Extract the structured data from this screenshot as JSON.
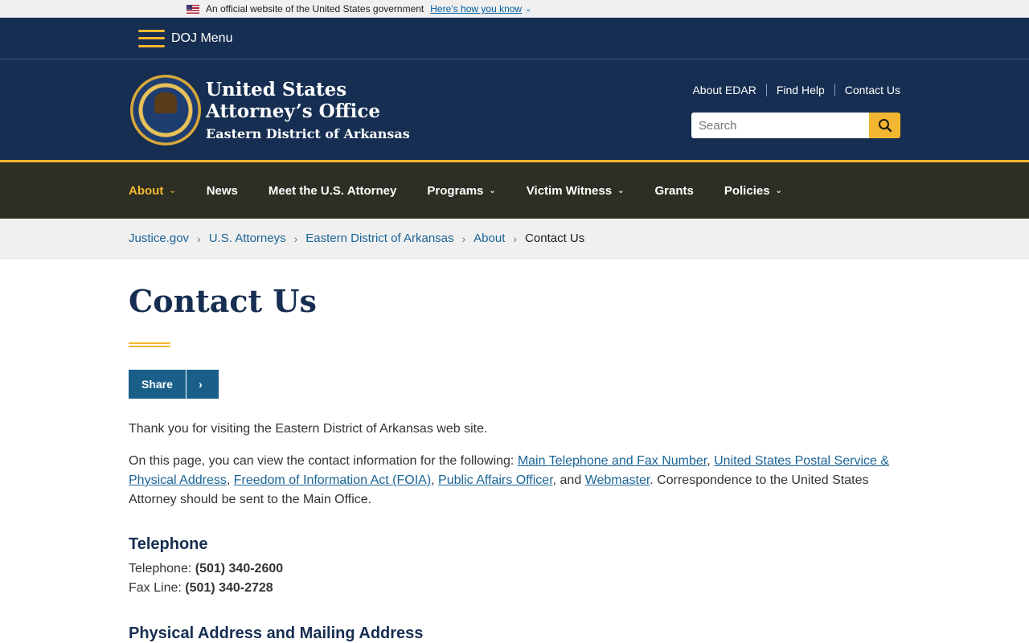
{
  "gov_banner": {
    "text": "An official website of the United States government",
    "link": "Here’s how you know"
  },
  "doj_menu": {
    "label": "DOJ Menu"
  },
  "header": {
    "title_line1": "United States",
    "title_line2": "Attorney’s Office",
    "title_line3": "Eastern District of Arkansas",
    "utility_links": [
      "About EDAR",
      "Find Help",
      "Contact Us"
    ],
    "search_placeholder": "Search"
  },
  "nav": {
    "items": [
      "About",
      "News",
      "Meet the U.S. Attorney",
      "Programs",
      "Victim Witness",
      "Grants",
      "Policies"
    ],
    "active": "About"
  },
  "breadcrumb": {
    "items": [
      "Justice.gov",
      "U.S. Attorneys",
      "Eastern District of Arkansas",
      "About"
    ],
    "current": "Contact Us"
  },
  "content": {
    "title": "Contact Us",
    "share_label": "Share",
    "intro": "Thank you for visiting the Eastern District of Arkansas web site.",
    "body_prefix": "On this page, you can view the contact information for the following: ",
    "links": [
      "Main Telephone and Fax Number",
      "United States Postal Service & Physical Address",
      "Freedom of Information Act (FOIA)",
      "Public Affairs Officer",
      "Webmaster"
    ],
    "sep_comma": ", ",
    "sep_and": ", and ",
    "body_suffix": ". Correspondence to the United States Attorney should be sent to the Main Office.",
    "telephone_heading": "Telephone",
    "telephone_label": "Telephone: ",
    "telephone_value": "(501) 340-2600",
    "fax_label": "Fax Line: ",
    "fax_value": "(501) 340-2728",
    "address_heading": "Physical Address and Mailing Address"
  },
  "colors": {
    "navy": "#162e51",
    "gold": "#f2b630",
    "nav_bg": "#2d2e24",
    "link": "#1a6496"
  }
}
